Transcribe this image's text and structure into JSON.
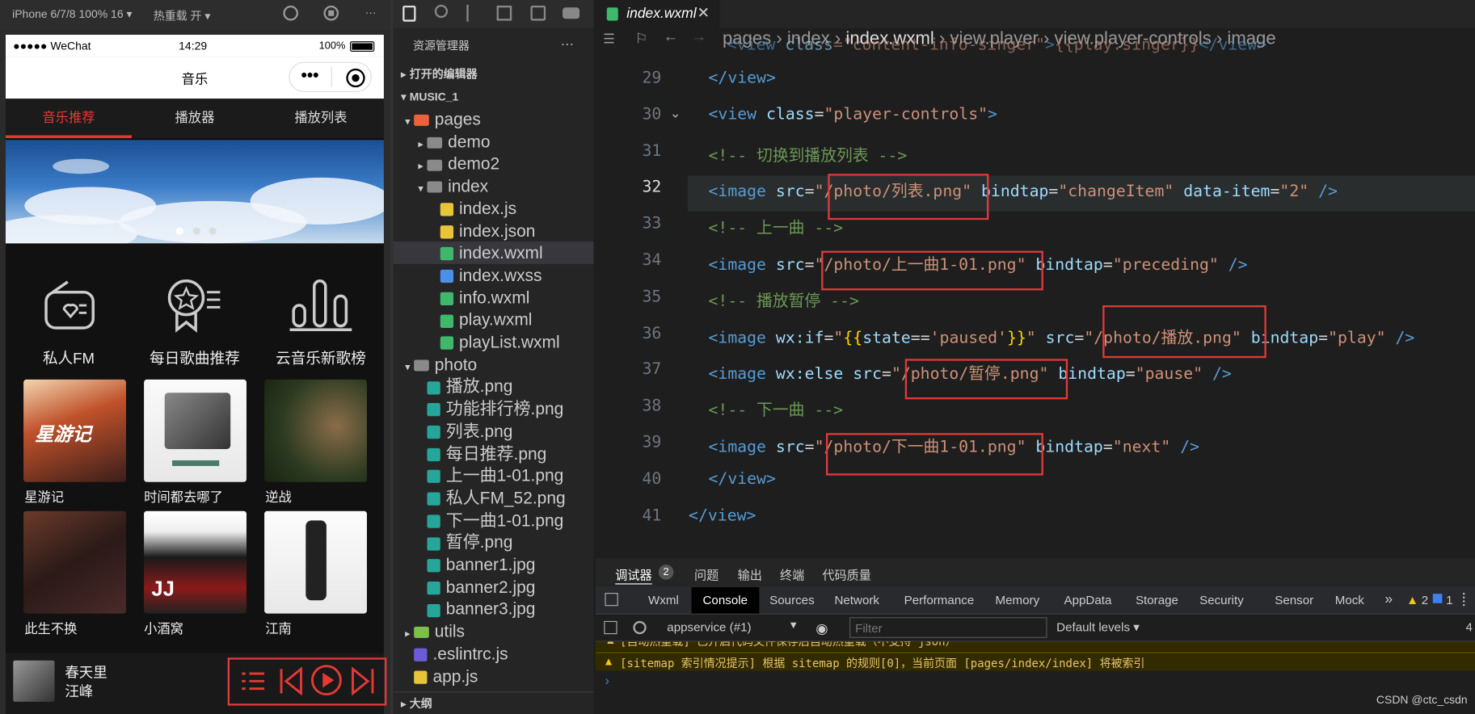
{
  "simulator": {
    "device": "iPhone 6/7/8 100% 16 ▾",
    "hotreload": "热重载 开 ▾",
    "more": "···"
  },
  "phone": {
    "carrier": "●●●●● WeChat",
    "time": "14:29",
    "battery": "100%",
    "title": "音乐",
    "capsule_dots": "•••"
  },
  "tabs": [
    "音乐推荐",
    "播放器",
    "播放列表"
  ],
  "icons": [
    "私人FM",
    "每日歌曲推荐",
    "云音乐新歌榜"
  ],
  "albums": [
    "星游记",
    "时间都去哪了",
    "逆战",
    "此生不换",
    "小酒窝",
    "江南"
  ],
  "player": {
    "song": "春天里",
    "singer": "汪峰"
  },
  "explorer": {
    "title": "资源管理器",
    "more": "···",
    "open_editors": "打开的编辑器",
    "project": "MUSIC_1",
    "outline": "大纲",
    "items": [
      {
        "name": "pages",
        "indent": 1,
        "kind": "folder-open",
        "arrow": "▾"
      },
      {
        "name": "demo",
        "indent": 2,
        "kind": "folder",
        "arrow": "▸"
      },
      {
        "name": "demo2",
        "indent": 2,
        "kind": "folder",
        "arrow": "▸"
      },
      {
        "name": "index",
        "indent": 2,
        "kind": "folder-open",
        "arrow": "▾"
      },
      {
        "name": "index.js",
        "indent": 3,
        "kind": "js",
        "arrow": ""
      },
      {
        "name": "index.json",
        "indent": 3,
        "kind": "json",
        "arrow": ""
      },
      {
        "name": "index.wxml",
        "indent": 3,
        "kind": "wxml",
        "arrow": ""
      },
      {
        "name": "index.wxss",
        "indent": 3,
        "kind": "wxss",
        "arrow": ""
      },
      {
        "name": "info.wxml",
        "indent": 3,
        "kind": "wxml",
        "arrow": ""
      },
      {
        "name": "play.wxml",
        "indent": 3,
        "kind": "wxml",
        "arrow": ""
      },
      {
        "name": "playList.wxml",
        "indent": 3,
        "kind": "wxml",
        "arrow": ""
      },
      {
        "name": "photo",
        "indent": 1,
        "kind": "folder-open",
        "arrow": "▾"
      },
      {
        "name": "播放.png",
        "indent": 2,
        "kind": "img",
        "arrow": ""
      },
      {
        "name": "功能排行榜.png",
        "indent": 2,
        "kind": "img",
        "arrow": ""
      },
      {
        "name": "列表.png",
        "indent": 2,
        "kind": "img",
        "arrow": ""
      },
      {
        "name": "每日推荐.png",
        "indent": 2,
        "kind": "img",
        "arrow": ""
      },
      {
        "name": "上一曲1-01.png",
        "indent": 2,
        "kind": "img",
        "arrow": ""
      },
      {
        "name": "私人FM_52.png",
        "indent": 2,
        "kind": "img",
        "arrow": ""
      },
      {
        "name": "下一曲1-01.png",
        "indent": 2,
        "kind": "img",
        "arrow": ""
      },
      {
        "name": "暂停.png",
        "indent": 2,
        "kind": "img",
        "arrow": ""
      },
      {
        "name": "banner1.jpg",
        "indent": 2,
        "kind": "img",
        "arrow": ""
      },
      {
        "name": "banner2.jpg",
        "indent": 2,
        "kind": "img",
        "arrow": ""
      },
      {
        "name": "banner3.jpg",
        "indent": 2,
        "kind": "img",
        "arrow": ""
      },
      {
        "name": "utils",
        "indent": 1,
        "kind": "folder",
        "arrow": "▸"
      },
      {
        "name": ".eslintrc.js",
        "indent": 1,
        "kind": "eslint",
        "arrow": ""
      },
      {
        "name": "app.js",
        "indent": 1,
        "kind": "js",
        "arrow": ""
      }
    ]
  },
  "editor": {
    "tab": "index.wxml",
    "breadcrumb": [
      "pages",
      "index",
      "index.wxml",
      "view.player",
      "view.player-controls",
      "image"
    ],
    "lines": [
      {
        "n": "29",
        "html": "<span class='tag'>&lt;/view&gt;</span>",
        "indent": 1
      },
      {
        "n": "30",
        "html": "<span class='tag'>&lt;view</span> <span class='attr'>class</span>=<span class='str'>\"player-controls\"</span><span class='tag'>&gt;</span>",
        "indent": 1
      },
      {
        "n": "31",
        "html": "<span class='cmt'>&lt;!-- 切换到播放列表 --&gt;</span>",
        "indent": 1
      },
      {
        "n": "32",
        "html": "<span class='tag'>&lt;image</span> <span class='attr'>src</span>=<span class='str'>\"/photo/列表.png\"</span> <span class='attr'>bindtap</span>=<span class='str'>\"changeItem\"</span> <span class='attr'>data-item</span>=<span class='str'>\"2\"</span> <span class='tag'>/&gt;</span>",
        "indent": 1
      },
      {
        "n": "33",
        "html": "<span class='cmt'>&lt;!-- 上一曲 --&gt;</span>",
        "indent": 1
      },
      {
        "n": "34",
        "html": "<span class='tag'>&lt;image</span> <span class='attr'>src</span>=<span class='str'>\"/photo/上一曲1-01.png\"</span> <span class='attr'>bindtap</span>=<span class='str'>\"preceding\"</span> <span class='tag'>/&gt;</span>",
        "indent": 1
      },
      {
        "n": "35",
        "html": "<span class='cmt'>&lt;!-- 播放暂停 --&gt;</span>",
        "indent": 1
      },
      {
        "n": "36",
        "html": "<span class='tag'>&lt;image</span> <span class='attr'>wx:if</span>=<span class='str'>\"</span><span style='color:#ffd700'>{{</span><span class='attr'>state</span>==<span class='str'>'paused'</span><span style='color:#ffd700'>}}</span><span class='str'>\"</span> <span class='attr'>src</span>=<span class='str'>\"/photo/播放.png\"</span> <span class='attr'>bindtap</span>=<span class='str'>\"play\"</span> <span class='tag'>/&gt;</span>",
        "indent": 1
      },
      {
        "n": "37",
        "html": "<span class='tag'>&lt;image</span> <span class='attr'>wx:else</span> <span class='attr'>src</span>=<span class='str'>\"/photo/暂停.png\"</span> <span class='attr'>bindtap</span>=<span class='str'>\"pause\"</span> <span class='tag'>/&gt;</span>",
        "indent": 1
      },
      {
        "n": "38",
        "html": "<span class='cmt'>&lt;!-- 下一曲 --&gt;</span>",
        "indent": 1
      },
      {
        "n": "39",
        "html": "<span class='tag'>&lt;image</span> <span class='attr'>src</span>=<span class='str'>\"/photo/下一曲1-01.png\"</span> <span class='attr'>bindtap</span>=<span class='str'>\"next\"</span> <span class='tag'>/&gt;</span>",
        "indent": 1
      },
      {
        "n": "40",
        "html": "<span class='tag'>&lt;/view&gt;</span>",
        "indent": 1
      },
      {
        "n": "41",
        "html": "<span class='tag'>&lt;/view&gt;</span>",
        "indent": 0
      }
    ]
  },
  "devtools": {
    "top_tabs": [
      "调试器",
      "问题",
      "输出",
      "终端",
      "代码质量"
    ],
    "badge": "2",
    "tabs": [
      "Wxml",
      "Console",
      "Sources",
      "Network",
      "Performance",
      "Memory",
      "AppData",
      "Storage",
      "Security",
      "Sensor",
      "Mock"
    ],
    "context": "appservice (#1)",
    "filter_placeholder": "Filter",
    "levels": "Default levels ▾",
    "warn_count": "2",
    "info_count": "1",
    "right_num": "4",
    "msg1": "[自动热重载] 已开启代码文件保存后自动热重载（不支持 json）",
    "msg2": "[sitemap 索引情况提示] 根据 sitemap 的规则[0]，当前页面 [pages/index/index] 将被索引",
    "prompt": "›",
    "watermark": "CSDN @ctc_csdn"
  },
  "colors": {
    "accent": "#e53935",
    "highlight": "#e03a3a"
  }
}
